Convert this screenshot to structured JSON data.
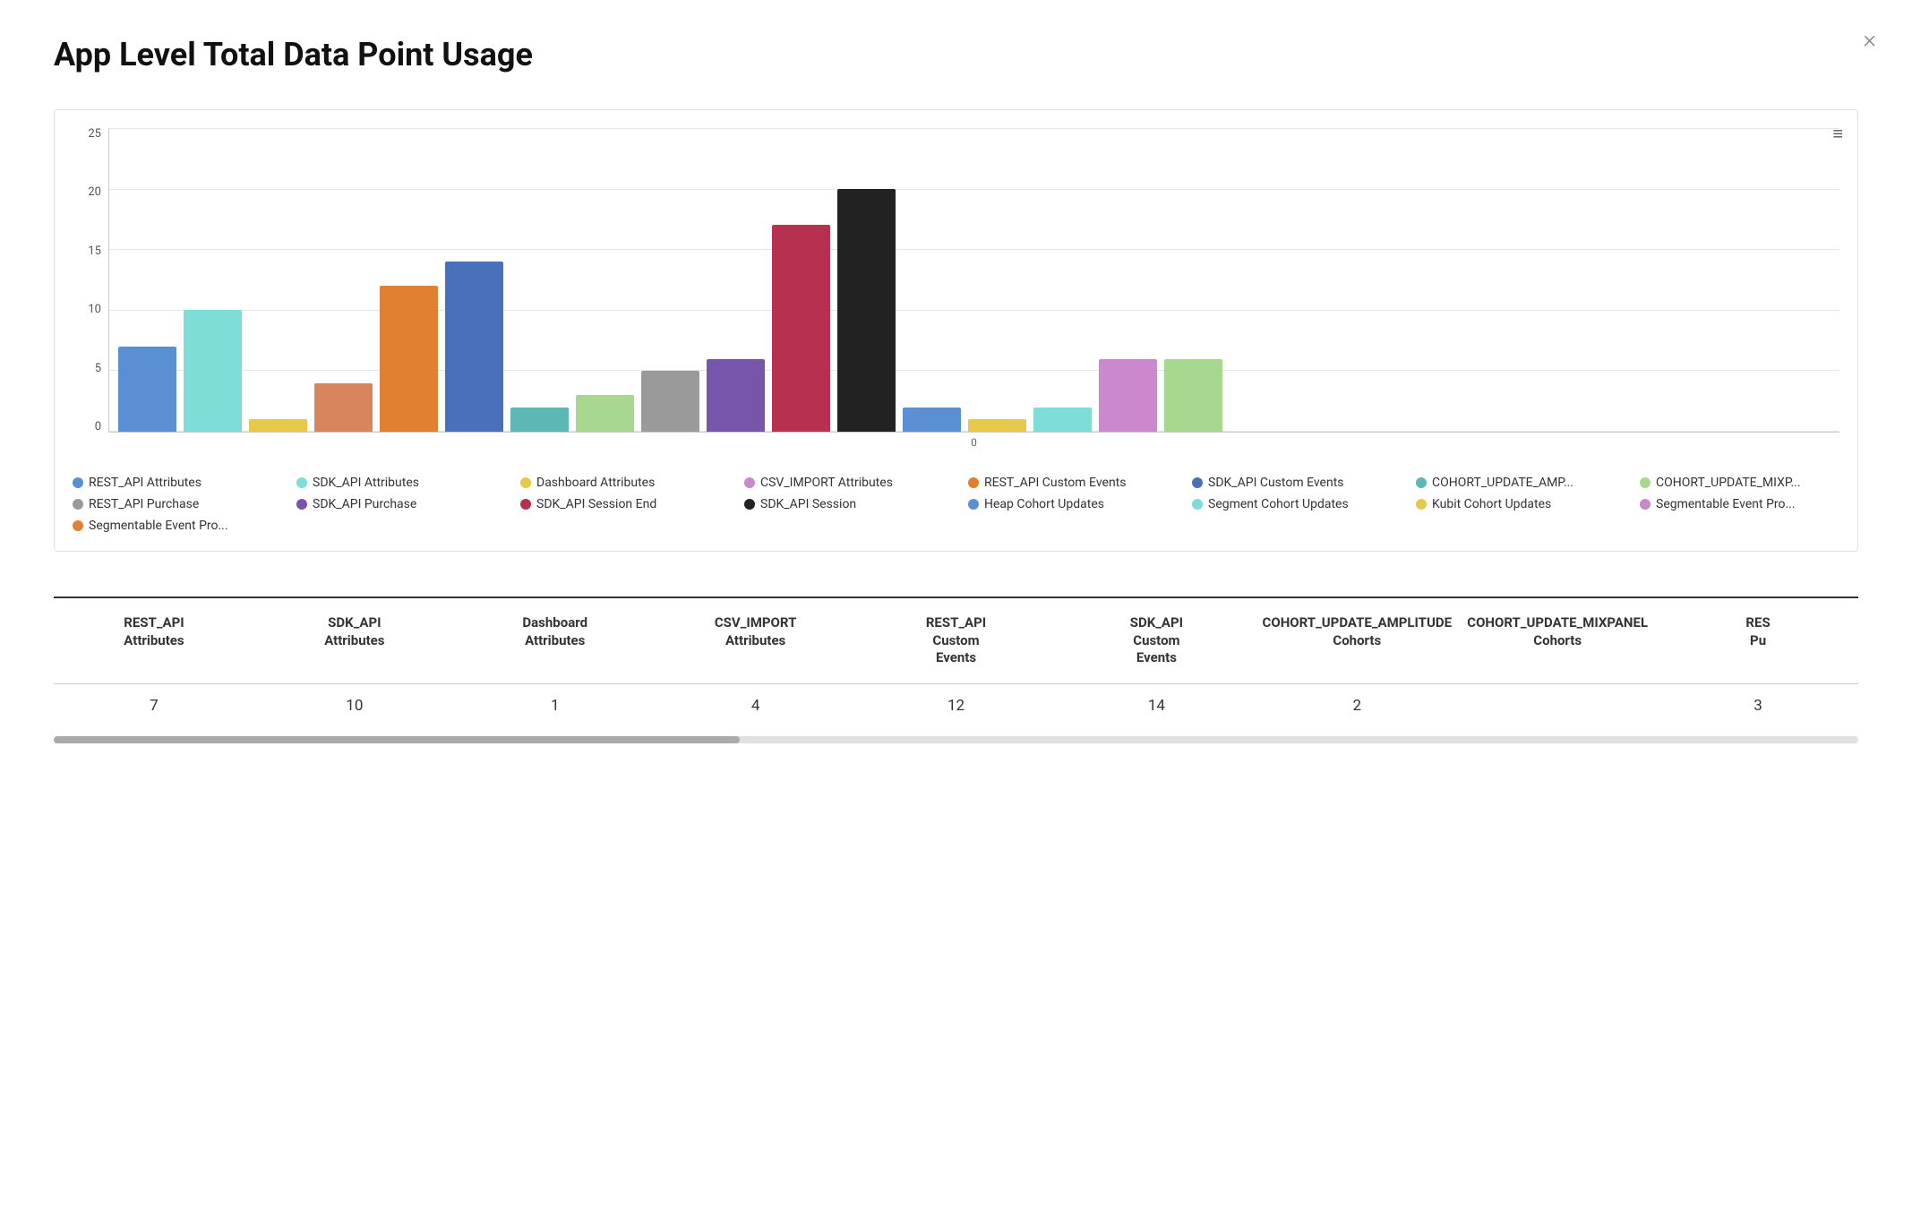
{
  "title": "App Level Total Data Point Usage",
  "close_label": "×",
  "chart_menu_icon": "≡",
  "yaxis": {
    "labels": [
      "0",
      "5",
      "10",
      "15",
      "20",
      "25"
    ]
  },
  "x_zero_label": "0",
  "bars": [
    {
      "id": "rest_api_attr",
      "color": "#5B8FD4",
      "value": 7,
      "max": 25
    },
    {
      "id": "sdk_api_attr",
      "color": "#7EDDD6",
      "value": 10,
      "max": 25
    },
    {
      "id": "dashboard_attr",
      "color": "#E8C84A",
      "value": 1,
      "max": 25
    },
    {
      "id": "csv_import_attr",
      "color": "#D9845A",
      "value": 4,
      "max": 25
    },
    {
      "id": "rest_api_custom",
      "color": "#E08030",
      "value": 12,
      "max": 25
    },
    {
      "id": "sdk_api_custom",
      "color": "#4A6FBB",
      "value": 14,
      "max": 25
    },
    {
      "id": "cohort_amp",
      "color": "#5CB8B2",
      "value": 2,
      "max": 25
    },
    {
      "id": "cohort_mix",
      "color": "#A8D890",
      "value": 3,
      "max": 25
    },
    {
      "id": "rest_api_purchase",
      "color": "#9A9A9A",
      "value": 5,
      "max": 25
    },
    {
      "id": "sdk_api_purchase",
      "color": "#7755AA",
      "value": 6,
      "max": 25
    },
    {
      "id": "sdk_session_end",
      "color": "#B83050",
      "value": 17,
      "max": 25
    },
    {
      "id": "sdk_session",
      "color": "#222222",
      "value": 20,
      "max": 25
    },
    {
      "id": "heap_cohort",
      "color": "#5B8FD4",
      "value": 2,
      "max": 25
    },
    {
      "id": "kubit_cohort",
      "color": "#E8C84A",
      "value": 1,
      "max": 25
    },
    {
      "id": "segment_cohort",
      "color": "#7EDDD6",
      "value": 2,
      "max": 25
    },
    {
      "id": "csv_import_attr2",
      "color": "#CC88CC",
      "value": 6,
      "max": 25
    },
    {
      "id": "cohort_mixp2",
      "color": "#A8D890",
      "value": 6,
      "max": 25
    },
    {
      "id": "segmentable2",
      "color": "#E08030",
      "value": 0,
      "max": 25
    }
  ],
  "legend": [
    {
      "label": "REST_API Attributes",
      "color": "#5B8FD4"
    },
    {
      "label": "SDK_API Attributes",
      "color": "#7EDDD6"
    },
    {
      "label": "Dashboard Attributes",
      "color": "#E8C84A"
    },
    {
      "label": "CSV_IMPORT Attributes",
      "color": "#CC88CC"
    },
    {
      "label": "REST_API Custom Events",
      "color": "#E08030"
    },
    {
      "label": "SDK_API Custom Events",
      "color": "#4A6FBB"
    },
    {
      "label": "COHORT_UPDATE_AMP...",
      "color": "#5CB8B2"
    },
    {
      "label": "COHORT_UPDATE_MIXP...",
      "color": "#A8D890"
    },
    {
      "label": "REST_API Purchase",
      "color": "#9A9A9A"
    },
    {
      "label": "SDK_API Purchase",
      "color": "#7755AA"
    },
    {
      "label": "SDK_API Session End",
      "color": "#B83050"
    },
    {
      "label": "SDK_API Session",
      "color": "#222222"
    },
    {
      "label": "Heap Cohort Updates",
      "color": "#5B8FD4"
    },
    {
      "label": "Segment Cohort Updates",
      "color": "#7EDDD6"
    },
    {
      "label": "Kubit Cohort Updates",
      "color": "#E8C84A"
    },
    {
      "label": "Segmentable Event Pro...",
      "color": "#CC88CC"
    },
    {
      "label": "Segmentable Event Pro...",
      "color": "#E08030"
    }
  ],
  "table": {
    "columns": [
      {
        "header": "REST_API\nAttributes",
        "value": "7"
      },
      {
        "header": "SDK_API\nAttributes",
        "value": "10"
      },
      {
        "header": "Dashboard\nAttributes",
        "value": "1"
      },
      {
        "header": "CSV_IMPORT\nAttributes",
        "value": "4"
      },
      {
        "header": "REST_API\nCustom\nEvents",
        "value": "12"
      },
      {
        "header": "SDK_API\nCustom\nEvents",
        "value": "14"
      },
      {
        "header": "COHORT_UPDATE_AMPLITUDE\nCohorts",
        "value": "2"
      },
      {
        "header": "COHORT_UPDATE_MIXPANEL\nCohorts",
        "value": ""
      },
      {
        "header": "RES\nPu",
        "value": "3"
      }
    ]
  }
}
